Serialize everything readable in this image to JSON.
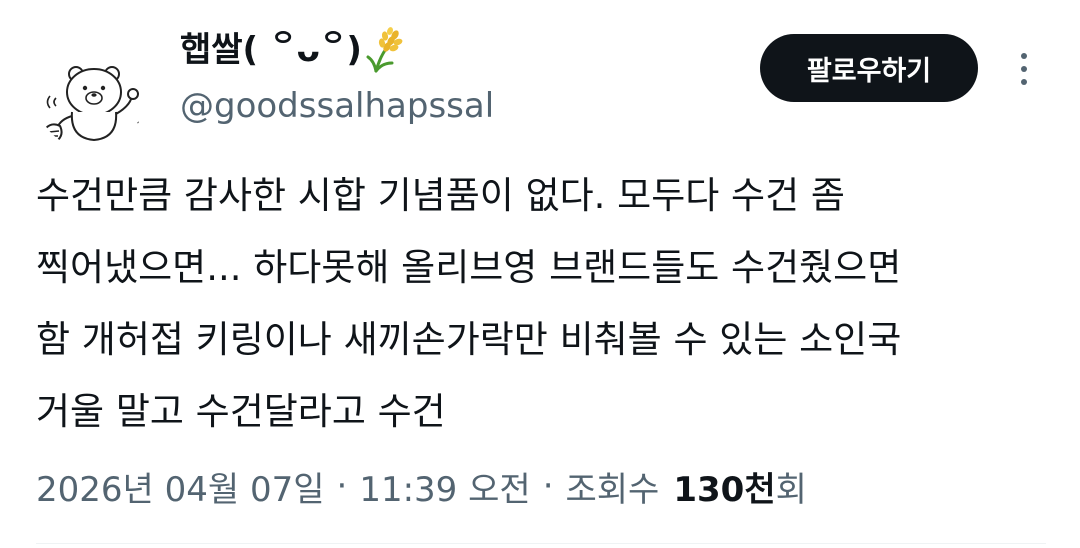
{
  "author": {
    "display_name": "햅쌀( ꒪ᴗ꒪)",
    "name_emoji_icon": "rice-ear-icon",
    "handle": "@goodssalhapssal",
    "avatar_icon": "bear-avatar-icon"
  },
  "actions": {
    "follow_label": "팔로우하기",
    "more_icon": "more-vertical-icon"
  },
  "post": {
    "lines": [
      "수건만큼 감사한 시합 기념품이 없다. 모두다 수건 좀",
      "찍어냈으면... 하다못해 올리브영 브랜드들도 수건줬으면",
      "함 개허접 키링이나 새끼손가락만 비춰볼 수 있는 소인국",
      "거울 말고 수건달라고 수건"
    ]
  },
  "meta": {
    "date": "2026년 04월 07일",
    "separator": "·",
    "time": "11:39 오전",
    "views_label": "조회수",
    "views_count": "130천",
    "views_suffix": "회"
  },
  "colors": {
    "text_primary": "#0f1419",
    "text_secondary": "#536471",
    "follow_bg": "#0f1419",
    "follow_fg": "#ffffff",
    "divider": "#eff3f4"
  }
}
